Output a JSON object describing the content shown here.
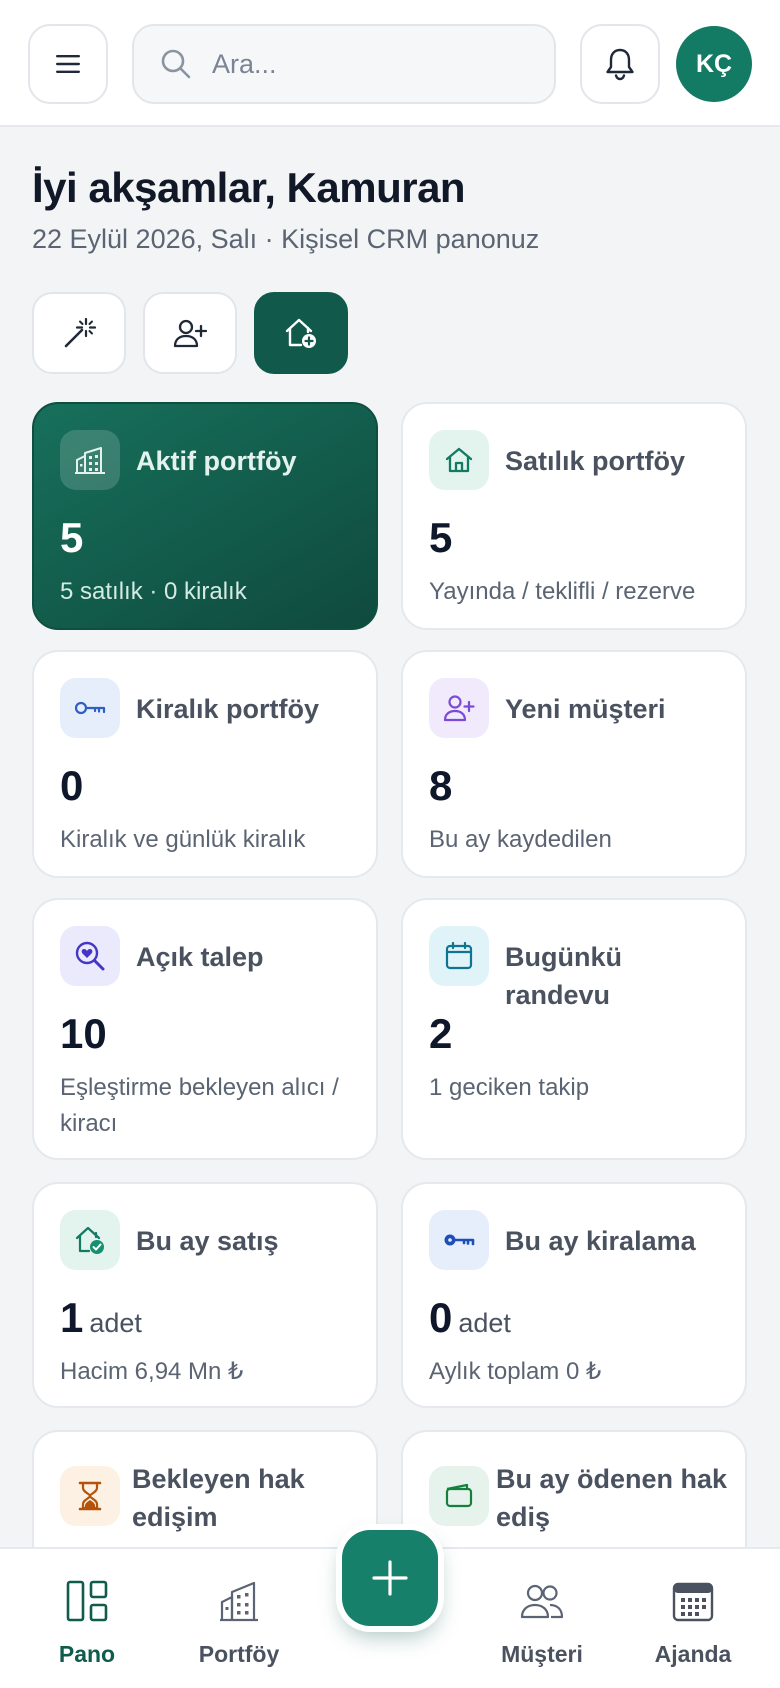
{
  "header": {
    "search_placeholder": "Ara...",
    "avatar_initials": "KÇ"
  },
  "greeting": {
    "title": "İyi akşamlar, Kamuran",
    "subtitle": "22 Eylül 2026, Salı · Kişisel CRM panonuz"
  },
  "quick_actions": [
    {
      "icon": "magic-wand-icon"
    },
    {
      "icon": "add-user-icon"
    },
    {
      "icon": "add-property-icon"
    }
  ],
  "cards": [
    {
      "title": "Aktif portföy",
      "value": "5",
      "desc": "5 satılık · 0 kiralık",
      "icon": "building-icon"
    },
    {
      "title": "Satılık portföy",
      "value": "5",
      "desc": "Yayında / teklifli / rezerve",
      "icon": "house-icon"
    },
    {
      "title": "Kiralık portföy",
      "value": "0",
      "desc": "Kiralık ve günlük kiralık",
      "icon": "key-icon"
    },
    {
      "title": "Yeni müşteri",
      "value": "8",
      "desc": "Bu ay kaydedilen",
      "icon": "add-user-icon"
    },
    {
      "title": "Açık talep",
      "value": "10",
      "desc": "Eşleştirme bekleyen alıcı / kiracı",
      "icon": "heart-search-icon"
    },
    {
      "title": "Bugünkü randevu",
      "value": "2",
      "desc": "1 geciken takip",
      "icon": "calendar-icon"
    },
    {
      "title": "Bu ay satış",
      "value": "1",
      "unit": "adet",
      "desc": "Hacim 6,94 Mn ₺",
      "icon": "house-check-icon"
    },
    {
      "title": "Bu ay kiralama",
      "value": "0",
      "unit": "adet",
      "desc": "Aylık toplam 0 ₺",
      "icon": "key-icon"
    },
    {
      "title": "Bekleyen hak edişim",
      "icon": "hourglass-icon"
    },
    {
      "title": "Bu ay ödenen hak ediş",
      "icon": "wallet-icon"
    }
  ],
  "nav": {
    "pano": "Pano",
    "portfoy": "Portföy",
    "musteri": "Müşteri",
    "ajanda": "Ajanda"
  },
  "colors": {
    "accent": "#137a63",
    "accent_dark": "#0f4a3e"
  }
}
